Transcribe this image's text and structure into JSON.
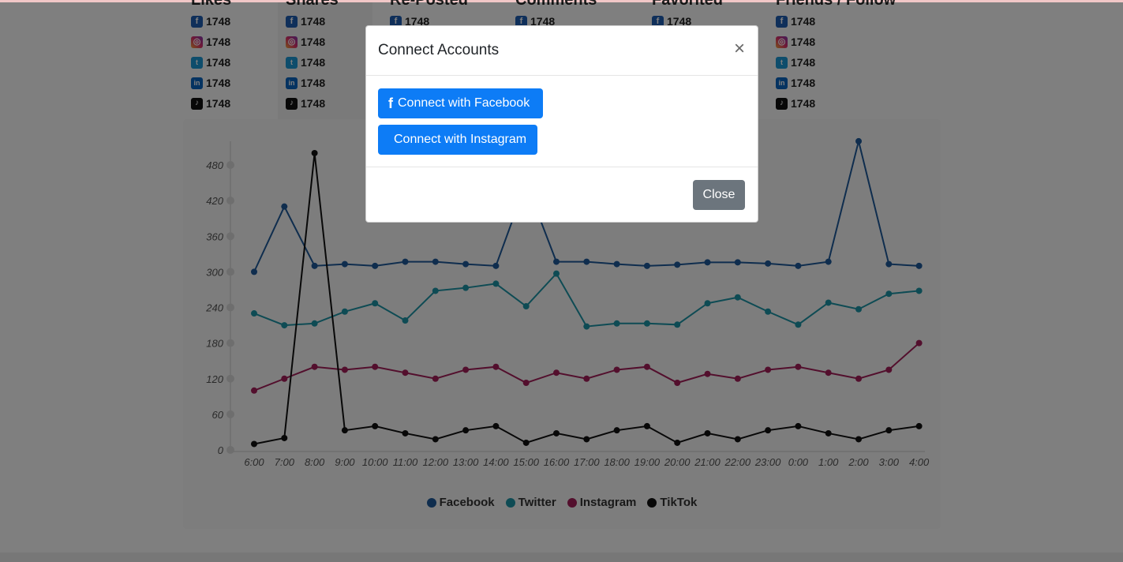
{
  "stats": {
    "columns": [
      {
        "heading": "Likes",
        "shaded": false
      },
      {
        "heading": "Shares",
        "shaded": true
      },
      {
        "heading": "Re-Posted",
        "shaded": false
      },
      {
        "heading": "Comments",
        "shaded": false
      },
      {
        "heading": "Favorited",
        "shaded": false
      },
      {
        "heading": "Friends / Follow",
        "shaded": false
      }
    ],
    "rows": [
      {
        "icon": "facebook-icon",
        "glyph": "f",
        "value": "1748"
      },
      {
        "icon": "instagram-icon",
        "glyph": "◎",
        "value": "1748"
      },
      {
        "icon": "twitter-icon",
        "glyph": "t",
        "value": "1748"
      },
      {
        "icon": "linkedin-icon",
        "glyph": "in",
        "value": "1748"
      },
      {
        "icon": "tiktok-icon",
        "glyph": "♪",
        "value": "1748"
      }
    ]
  },
  "chart_data": {
    "type": "line",
    "x": [
      "6:00",
      "7:00",
      "8:00",
      "9:00",
      "10:00",
      "11:00",
      "12:00",
      "13:00",
      "14:00",
      "15:00",
      "16:00",
      "17:00",
      "18:00",
      "19:00",
      "20:00",
      "21:00",
      "22:00",
      "23:00",
      "0:00",
      "1:00",
      "2:00",
      "3:00",
      "4:00"
    ],
    "ylim": [
      0,
      480
    ],
    "yticks": [
      0,
      60,
      120,
      180,
      240,
      300,
      360,
      420,
      480
    ],
    "series": [
      {
        "name": "Facebook",
        "color": "#1e5b9c",
        "values": [
          300,
          410,
          310,
          313,
          310,
          317,
          317,
          313,
          310,
          450,
          317,
          317,
          313,
          310,
          312,
          316,
          316,
          314,
          310,
          317,
          520,
          313,
          310
        ]
      },
      {
        "name": "Twitter",
        "color": "#1c97a8",
        "values": [
          230,
          210,
          213,
          233,
          247,
          218,
          268,
          273,
          280,
          242,
          297,
          208,
          213,
          213,
          211,
          247,
          257,
          233,
          211,
          248,
          237,
          263,
          268
        ]
      },
      {
        "name": "Instagram",
        "color": "#a61e5a",
        "values": [
          100,
          120,
          140,
          135,
          140,
          130,
          120,
          135,
          140,
          113,
          130,
          120,
          135,
          140,
          113,
          128,
          120,
          135,
          140,
          130,
          120,
          135,
          180
        ]
      },
      {
        "name": "TikTok",
        "color": "#111111",
        "values": [
          10,
          20,
          500,
          33,
          40,
          28,
          18,
          33,
          40,
          12,
          28,
          18,
          33,
          40,
          12,
          28,
          18,
          33,
          40,
          28,
          18,
          33,
          40
        ]
      }
    ],
    "legend": "bottom",
    "grid": false
  },
  "modal": {
    "title": "Connect Accounts",
    "close_symbol": "×",
    "facebook_glyph": "f",
    "connect_facebook_label": "Connect with Facebook",
    "connect_instagram_label": "Connect with Instagram",
    "close_label": "Close"
  }
}
